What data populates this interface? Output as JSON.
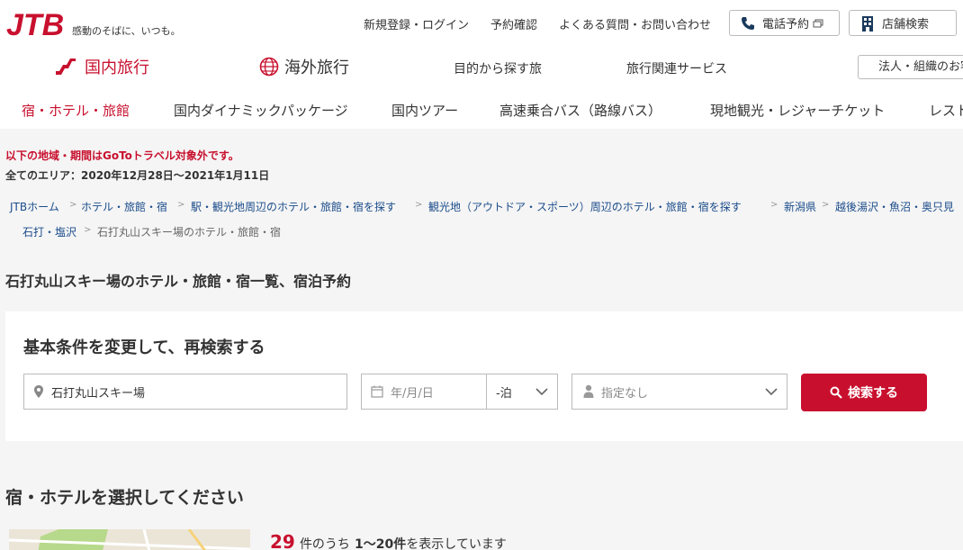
{
  "brand": {
    "logo_text": "JTB",
    "tagline": "感動のそばに、いつも。",
    "accent": "#c8102e",
    "link_color": "#1a4c8b"
  },
  "utility": {
    "register_login": "新規登録・ログイン",
    "reservation_check": "予約確認",
    "faq_contact": "よくある質問・お問い合わせ",
    "phone_reservation": "電話予約",
    "store_search": "店舗検索"
  },
  "main_nav": {
    "domestic": "国内旅行",
    "overseas": "海外旅行",
    "purpose": "目的から探す旅",
    "services": "旅行関連サービス",
    "corporate": "法人・組織のお客様"
  },
  "sub_nav": [
    "宿・ホテル・旅館",
    "国内ダイナミックパッケージ",
    "国内ツアー",
    "高速乗合バス（路線バス）",
    "現地観光・レジャーチケット",
    "レストラン"
  ],
  "notice": {
    "line1": "以下の地域・期間はGoToトラベル対象外です。",
    "line2": "全てのエリア：2020年12月28日〜2021年1月11日"
  },
  "breadcrumb": [
    "JTBホーム",
    "ホテル・旅館・宿",
    "駅・観光地周辺のホテル・旅館・宿を探す",
    "観光地（アウトドア・スポーツ）周辺のホテル・旅館・宿を探す",
    "新潟県",
    "越後湯沢・魚沼・奥只見",
    "石打・塩沢",
    "石打丸山スキー場のホテル・旅館・宿"
  ],
  "page_title": "石打丸山スキー場のホテル・旅館・宿一覧、宿泊予約",
  "search": {
    "title": "基本条件を変更して、再検索する",
    "location_value": "石打丸山スキー場",
    "date_placeholder": "年/月/日",
    "nights_value": "-泊",
    "guests_value": "指定なし",
    "button_label": "検索する"
  },
  "results": {
    "section_title": "宿・ホテルを選択してください",
    "total": "29",
    "total_suffix": "件のうち",
    "range": "1〜20件",
    "range_suffix": "を表示しています"
  },
  "icons": [
    "phone-icon",
    "building-icon",
    "window-icon",
    "torii-icon",
    "globe-icon",
    "pin-icon",
    "calendar-icon",
    "chevron-down-icon",
    "person-icon",
    "search-icon"
  ]
}
